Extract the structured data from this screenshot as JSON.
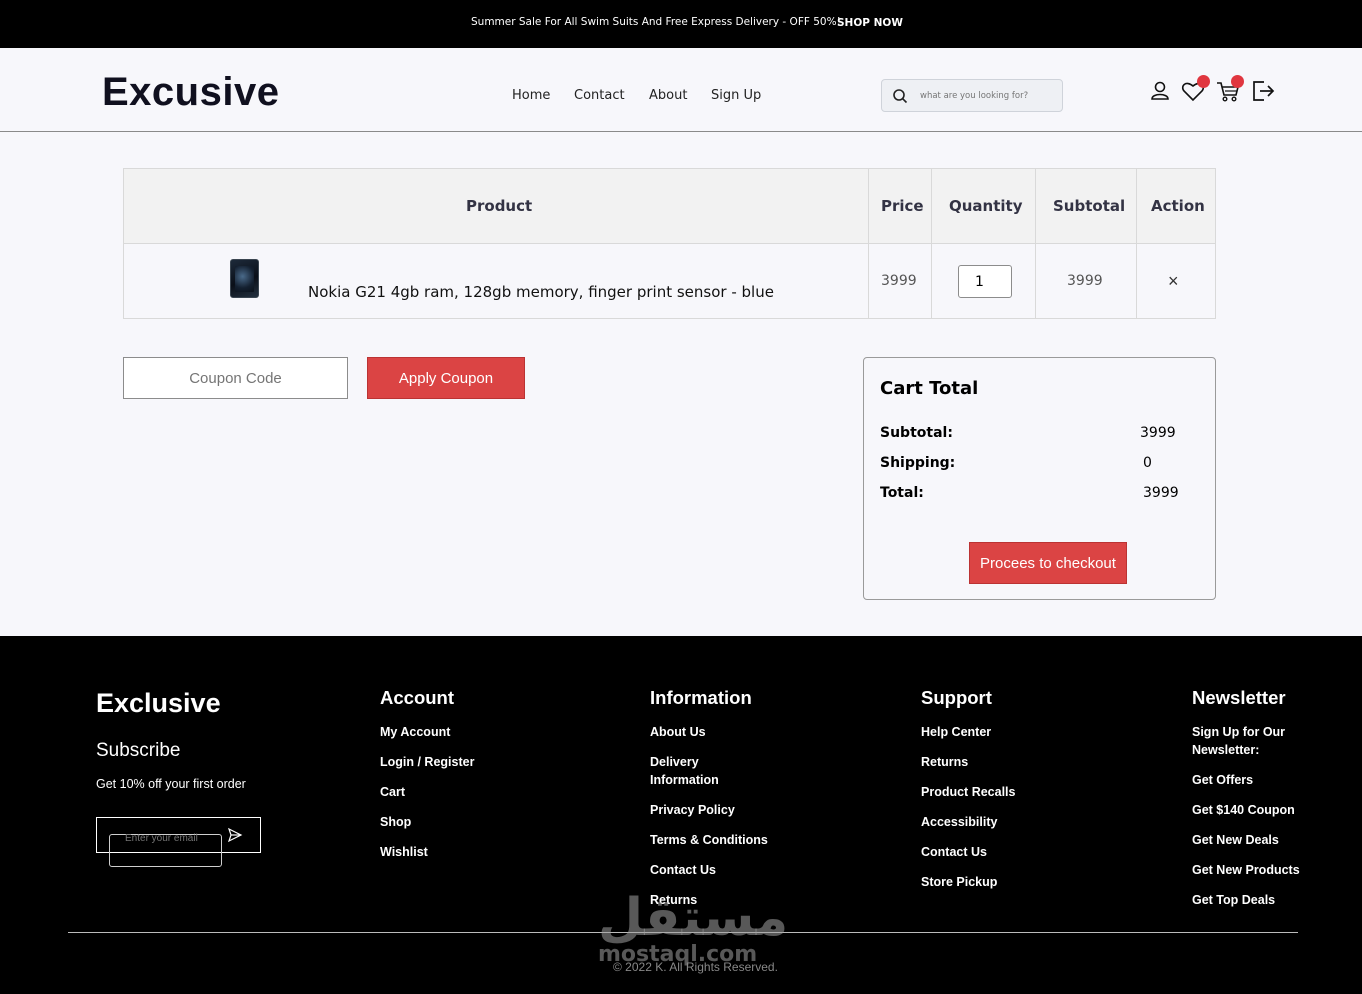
{
  "topbar": {
    "message": "Summer Sale For All Swim Suits And Free Express Delivery - OFF 50%!",
    "cta": "SHOP NOW"
  },
  "header": {
    "logo": "Excusive",
    "nav": [
      "Home",
      "Contact",
      "About",
      "Sign Up"
    ],
    "search_placeholder": "what are you looking for?"
  },
  "cart_table": {
    "headers": [
      "Product",
      "Price",
      "Quantity",
      "Subtotal",
      "Action"
    ],
    "rows": [
      {
        "name": "Nokia G21 4gb ram, 128gb memory, finger print sensor - blue",
        "price": "3999",
        "quantity": "1",
        "subtotal": "3999",
        "action": "×"
      }
    ]
  },
  "coupon": {
    "placeholder": "Coupon Code",
    "button": "Apply Coupon"
  },
  "cart_total": {
    "title": "Cart Total",
    "subtotal_label": "Subtotal:",
    "subtotal_value": "3999",
    "shipping_label": "Shipping:",
    "shipping_value": "0",
    "total_label": "Total:",
    "total_value": "3999",
    "checkout_button": "Procees to checkout"
  },
  "footer": {
    "brand": "Exclusive",
    "subscribe": "Subscribe",
    "offer": "Get 10% off your first order",
    "email_placeholder": "Enter your email",
    "columns": [
      {
        "title": "Account",
        "links": [
          "My Account",
          "Login / Register",
          "Cart",
          "Shop",
          "Wishlist"
        ]
      },
      {
        "title": "Information",
        "links": [
          "About Us",
          "Delivery Information",
          "Privacy Policy",
          "Terms & Conditions",
          "Contact Us",
          "Returns"
        ]
      },
      {
        "title": "Support",
        "links": [
          "Help Center",
          "Returns",
          "Product Recalls",
          "Accessibility",
          "Contact Us",
          "Store Pickup"
        ]
      },
      {
        "title": "Newsletter",
        "links": [
          "Sign Up for Our Newsletter:",
          "Get Offers",
          "Get $140 Coupon",
          "Get New Deals",
          "Get New Products",
          "Get Top Deals"
        ]
      }
    ],
    "copyright": "© 2022 K. All Rights Reserved.",
    "watermark": "مستقل",
    "watermark_sub": "mostaql.com"
  }
}
